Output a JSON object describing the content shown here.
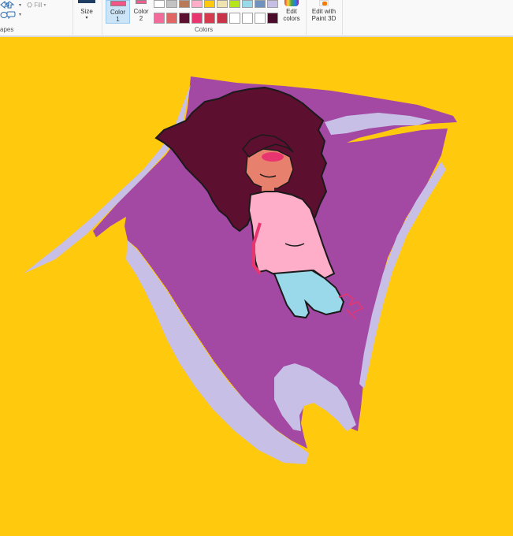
{
  "ribbon": {
    "shapes_group_label": "apes",
    "fill_label": "Fill",
    "size_label": "Size",
    "color1_label_line1": "Color",
    "color1_label_line2": "1",
    "color2_label_line1": "Color",
    "color2_label_line2": "2",
    "colors_group_label": "Colors",
    "edit_colors_line1": "Edit",
    "edit_colors_line2": "colors",
    "paint3d_line1": "Edit with",
    "paint3d_line2": "Paint 3D"
  },
  "colors": {
    "color1": "#f2548a",
    "color2": "#f25d90",
    "canvas_bg": "#ffc90e",
    "palette_row1": [
      "#ffffff",
      "#c3c3c3",
      "#b97a57",
      "#ffaec9",
      "#ffc90e",
      "#efe4b0",
      "#b5e61d",
      "#99d9ea",
      "#7092be",
      "#c8bfe7"
    ],
    "palette_row2": [
      "#f26b9b",
      "#e06666",
      "#5c0f2e",
      "#e8356f",
      "#d63a4e",
      "#c9334a",
      "#ffffff",
      "#ffffff",
      "#ffffff",
      "#ffffff"
    ],
    "palette_row3": [
      "#ffffff",
      "#ffffff",
      "#ffffff",
      "#ffffff",
      "#ffffff",
      "#ffffff",
      "#ffffff",
      "#ffffff",
      "#ffffff",
      "#ffffff"
    ],
    "custom_row2_last": "#4a0a2a"
  }
}
